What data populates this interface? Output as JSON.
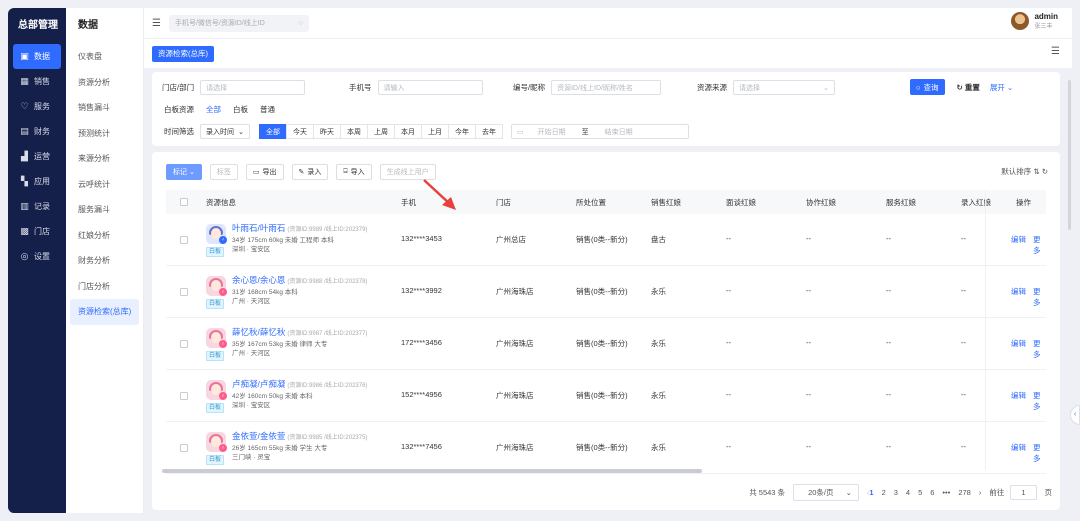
{
  "nav": {
    "title": "总部管理",
    "items": [
      {
        "icon": "data-icon",
        "glyph": "▣",
        "label": "数据",
        "active": true
      },
      {
        "icon": "sales-icon",
        "glyph": "▦",
        "label": "销售"
      },
      {
        "icon": "service-icon",
        "glyph": "♡",
        "label": "服务"
      },
      {
        "icon": "finance-icon",
        "glyph": "▤",
        "label": "财务"
      },
      {
        "icon": "operation-icon",
        "glyph": "▟",
        "label": "运营"
      },
      {
        "icon": "apps-icon",
        "glyph": "▚",
        "label": "应用"
      },
      {
        "icon": "record-icon",
        "glyph": "▥",
        "label": "记录"
      },
      {
        "icon": "store-icon",
        "glyph": "▩",
        "label": "门店"
      },
      {
        "icon": "settings-icon",
        "glyph": "◎",
        "label": "设置"
      }
    ]
  },
  "submenu": {
    "title": "数据",
    "items": [
      "仪表盘",
      "资源分析",
      "销售漏斗",
      "预测统计",
      "来源分析",
      "云呼统计",
      "服务漏斗",
      "红娘分析",
      "财务分析",
      "门店分析",
      "资源检索(总库)"
    ],
    "active_index": 10
  },
  "topbar": {
    "search_placeholder": "手机号/微信号/资源ID/线上ID",
    "user_name": "admin",
    "user_sub": "张三丰"
  },
  "tab": {
    "label": "资源检索(总库)"
  },
  "filters": {
    "store_label": "门店/部门",
    "store_placeholder": "请选择",
    "phone_label": "手机号",
    "phone_placeholder": "请输入",
    "code_label": "编号/昵称",
    "code_placeholder": "资源ID/线上ID/昵称/姓名",
    "source_label": "资源来源",
    "source_placeholder": "请选择",
    "query_label": "查询",
    "reset_label": "重置",
    "expand_label": "展开",
    "board_label": "白板资源",
    "board_options": [
      "全部",
      "白板",
      "普通"
    ],
    "time_label": "时间筛选",
    "time_type": "录入时间",
    "time_ranges": [
      "全部",
      "今天",
      "昨天",
      "本周",
      "上周",
      "本月",
      "上月",
      "今年",
      "去年"
    ],
    "start_placeholder": "开始日期",
    "to_label": "至",
    "end_placeholder": "结束日期"
  },
  "toolbar": {
    "mark_label": "标记",
    "tag_label": "标签",
    "export_label": "导出",
    "entry_label": "录入",
    "import_label": "导入",
    "generate_label": "生成线上用户",
    "sort_label": "默认排序"
  },
  "table": {
    "headers": [
      "资源信息",
      "手机",
      "门店",
      "所处位置",
      "销售红娘",
      "面谈红娘",
      "协作红娘",
      "服务红娘",
      "录入红娘",
      "操作"
    ],
    "rows": [
      {
        "name": "叶雨石/叶雨石",
        "ids": "(资源ID:9989 /线上ID:202379)",
        "info1": "34岁 175cm 60kg 未婚 工程师 本科",
        "info2": "深圳 · 宝安区",
        "gender": "male",
        "tag": "白板",
        "phone": "132****3453",
        "store": "广州总店",
        "position": "销售(0类--新分)",
        "sales": "盘古",
        "interview": "--",
        "collab": "--",
        "service": "--",
        "entry": "--",
        "edit": "编辑",
        "more": "更多"
      },
      {
        "name": "余心恩/余心恩",
        "ids": "(资源ID:9988 /线上ID:202378)",
        "info1": "31岁 168cm 54kg 本科",
        "info2": "广州 · 天河区",
        "gender": "female",
        "tag": "白板",
        "phone": "132****3992",
        "store": "广州海珠店",
        "position": "销售(0类--新分)",
        "sales": "永乐",
        "interview": "--",
        "collab": "--",
        "service": "--",
        "entry": "--",
        "edit": "编辑",
        "more": "更多"
      },
      {
        "name": "薛忆秋/薛忆秋",
        "ids": "(资源ID:9987 /线上ID:202377)",
        "info1": "35岁 167cm 53kg 未婚 律师 大专",
        "info2": "广州 · 天河区",
        "gender": "female",
        "tag": "白板",
        "phone": "172****3456",
        "store": "广州海珠店",
        "position": "销售(0类--新分)",
        "sales": "永乐",
        "interview": "--",
        "collab": "--",
        "service": "--",
        "entry": "--",
        "edit": "编辑",
        "more": "更多"
      },
      {
        "name": "卢痴凝/卢痴凝",
        "ids": "(资源ID:9986 /线上ID:202376)",
        "info1": "42岁 160cm 50kg 未婚 本科",
        "info2": "深圳 · 宝安区",
        "gender": "female",
        "tag": "白板",
        "phone": "152****4956",
        "store": "广州海珠店",
        "position": "销售(0类--新分)",
        "sales": "永乐",
        "interview": "--",
        "collab": "--",
        "service": "--",
        "entry": "--",
        "edit": "编辑",
        "more": "更多"
      },
      {
        "name": "金依萱/金依萱",
        "ids": "(资源ID:9985 /线上ID:202375)",
        "info1": "26岁 165cm 55kg 未婚 学生 大专",
        "info2": "三门峡 · 灵宝",
        "gender": "female",
        "tag": "白板",
        "phone": "132****7456",
        "store": "广州海珠店",
        "position": "销售(0类--新分)",
        "sales": "永乐",
        "interview": "--",
        "collab": "--",
        "service": "--",
        "entry": "--",
        "edit": "编辑",
        "more": "更多"
      }
    ]
  },
  "pagination": {
    "total": "共 5543 条",
    "page_size": "20条/页",
    "pages": [
      "1",
      "2",
      "3",
      "4",
      "5",
      "6",
      "•••",
      "278"
    ],
    "current": "1",
    "goto_label": "前往",
    "goto_value": "1",
    "page_suffix": "页"
  },
  "colors": {
    "accent": "#2f6bff",
    "nav_bg": "#14204a",
    "page_bg": "#eef0f5"
  }
}
